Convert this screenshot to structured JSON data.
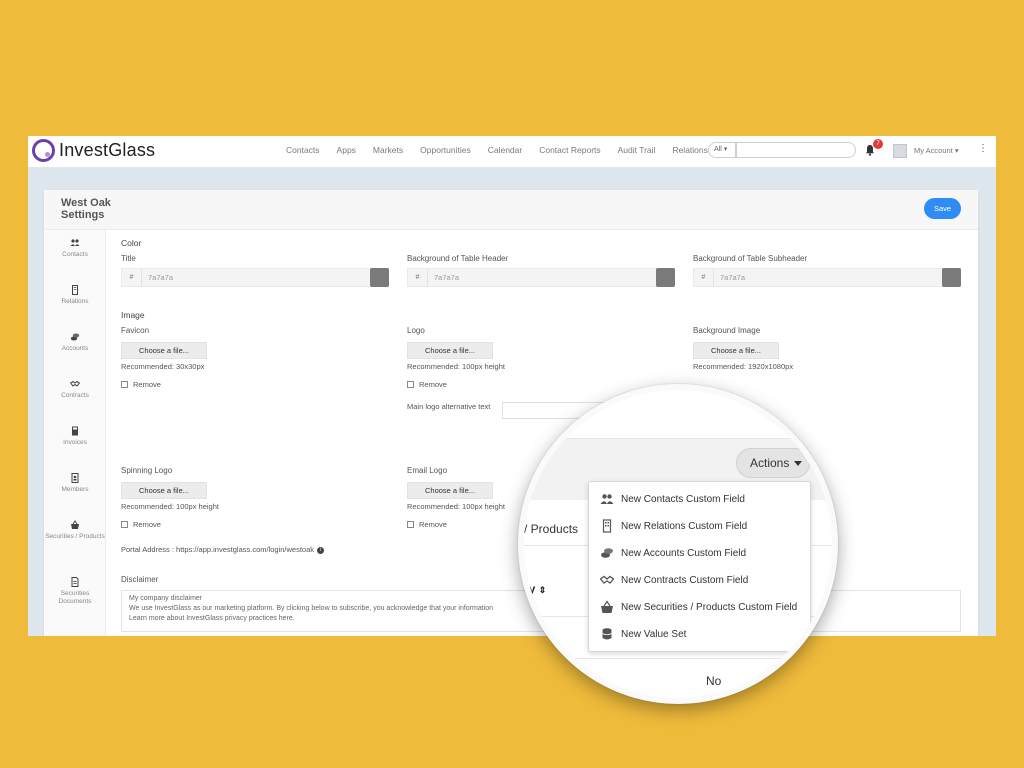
{
  "app": {
    "logo_text": "InvestGlass"
  },
  "nav": [
    "Contacts",
    "Apps",
    "Markets",
    "Opportunities",
    "Calendar",
    "Contact Reports",
    "Audit Trail",
    "Relations"
  ],
  "search": {
    "scope": "All",
    "placeholder": ""
  },
  "notifications": {
    "count": "7"
  },
  "account": {
    "label": "My Account"
  },
  "panel": {
    "title": "West Oak Settings",
    "save_label": "Save"
  },
  "sidebar": [
    {
      "label": "Contacts",
      "icon": "users-icon"
    },
    {
      "label": "Relations",
      "icon": "building-icon"
    },
    {
      "label": "Accounts",
      "icon": "coins-icon"
    },
    {
      "label": "Contracts",
      "icon": "handshake-icon"
    },
    {
      "label": "Invoices",
      "icon": "calculator-icon"
    },
    {
      "label": "Members",
      "icon": "id-badge-icon"
    },
    {
      "label": "Securities / Products",
      "icon": "basket-icon"
    },
    {
      "label": "Securities Documents",
      "icon": "document-icon"
    }
  ],
  "color": {
    "section": "Color",
    "fields": [
      {
        "label": "Title",
        "prefix": "#",
        "value": "7a7a7a",
        "swatch": "#7a7a7a"
      },
      {
        "label": "Background of Table Header",
        "prefix": "#",
        "value": "7a7a7a",
        "swatch": "#7a7a7a"
      },
      {
        "label": "Background of Table Subheader",
        "prefix": "#",
        "value": "7a7a7a",
        "swatch": "#7a7a7a"
      }
    ]
  },
  "image": {
    "section": "Image",
    "choose_label": "Choose a file...",
    "remove_label": "Remove",
    "favicon": {
      "label": "Favicon",
      "hint": "Recommended: 30x30px"
    },
    "logo": {
      "label": "Logo",
      "hint": "Recommended: 100px height"
    },
    "background": {
      "label": "Background Image",
      "hint": "Recommended: 1920x1080px"
    },
    "alt_text_label": "Main logo alternative text",
    "spinning": {
      "label": "Spinning Logo",
      "hint": "Recommended: 100px height"
    },
    "email": {
      "label": "Email Logo",
      "hint": "Recommended: 100px height"
    }
  },
  "portal": {
    "text": "Portal Address : https://app.investglass.com/login/westoak"
  },
  "disclaimer": {
    "label": "Disclaimer",
    "lines": [
      "My company disclaimer",
      "We use InvestGlass as our marketing platform. By clicking below to subscribe, you acknowledge that your information",
      "Learn more about InvestGlass privacy practices here."
    ]
  },
  "magnifier": {
    "actions_label": "Actions",
    "products_text": "/ Products",
    "category_text": "ry",
    "sort_icon": "sort-icon",
    "no_text": "No",
    "menu": [
      {
        "label": "New Contacts Custom Field",
        "icon": "users-icon"
      },
      {
        "label": "New Relations Custom Field",
        "icon": "building-icon"
      },
      {
        "label": "New Accounts Custom Field",
        "icon": "coins-icon"
      },
      {
        "label": "New Contracts Custom Field",
        "icon": "handshake-icon"
      },
      {
        "label": "New Securities / Products Custom Field",
        "icon": "basket-icon"
      },
      {
        "label": "New Value Set",
        "icon": "database-icon"
      }
    ]
  },
  "colors": {
    "background": "#efbb3b",
    "accent": "#2f8cf5",
    "brand": "#6b3fb0",
    "badge": "#e53935"
  }
}
